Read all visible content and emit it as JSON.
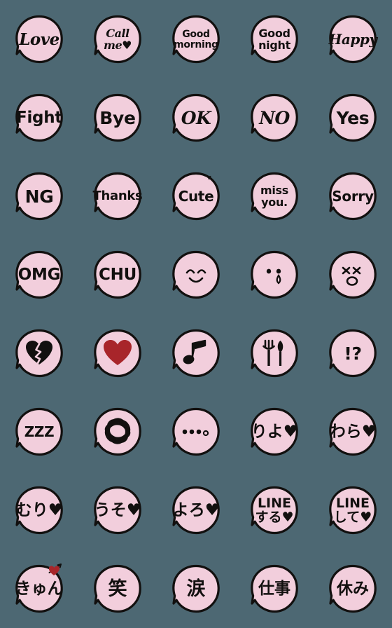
{
  "sheet": {
    "title": "Pink speech bubble emoji set",
    "columns": 5,
    "rows": 8,
    "background_color": "#4d6873",
    "bubble_fill_color": "#f2cedc",
    "bubble_outline_color": "#12100f",
    "ink_color": "#12100f",
    "accent_red": "#a8252a"
  },
  "stickers": [
    {
      "id": "love",
      "kind": "text",
      "style": "script",
      "size": "sz-24",
      "lines": [
        "Love"
      ]
    },
    {
      "id": "call-me",
      "kind": "text",
      "style": "script",
      "size": "sz-17",
      "lines": [
        "Call",
        "me♥"
      ]
    },
    {
      "id": "good-morning",
      "kind": "text",
      "style": "hand",
      "size": "sz-15",
      "lines": [
        "Good",
        "morning"
      ]
    },
    {
      "id": "good-night",
      "kind": "text",
      "style": "hand",
      "size": "sz-17",
      "lines": [
        "Good",
        "night"
      ]
    },
    {
      "id": "happy",
      "kind": "text",
      "style": "script",
      "size": "sz-21",
      "lines": [
        "Happy"
      ]
    },
    {
      "id": "fight",
      "kind": "text",
      "style": "hand",
      "size": "sz-24",
      "lines": [
        "Fight"
      ]
    },
    {
      "id": "bye",
      "kind": "text",
      "style": "hand",
      "size": "sz-28",
      "lines": [
        "Bye"
      ]
    },
    {
      "id": "ok",
      "kind": "text",
      "style": "script",
      "size": "sz-28",
      "lines": [
        "OK"
      ]
    },
    {
      "id": "no",
      "kind": "text",
      "style": "script",
      "size": "sz-28",
      "lines": [
        "NO"
      ]
    },
    {
      "id": "yes",
      "kind": "text",
      "style": "hand",
      "size": "sz-28",
      "lines": [
        "Yes"
      ]
    },
    {
      "id": "ng",
      "kind": "text",
      "style": "hand",
      "size": "sz-28",
      "lines": [
        "NG"
      ]
    },
    {
      "id": "thanks",
      "kind": "text",
      "style": "hand",
      "size": "sz-19",
      "lines": [
        "Thanks"
      ]
    },
    {
      "id": "cute",
      "kind": "text",
      "style": "hand",
      "size": "sz-21",
      "lines": [
        "Cute"
      ],
      "heart_above": true
    },
    {
      "id": "miss-you",
      "kind": "text",
      "style": "hand",
      "size": "sz-17",
      "lines": [
        "miss",
        "you."
      ]
    },
    {
      "id": "sorry",
      "kind": "text",
      "style": "hand",
      "size": "sz-21",
      "lines": [
        "Sorry"
      ]
    },
    {
      "id": "omg",
      "kind": "text",
      "style": "hand",
      "size": "sz-24",
      "lines": [
        "OMG"
      ]
    },
    {
      "id": "chu",
      "kind": "text",
      "style": "hand",
      "size": "sz-24",
      "lines": [
        "CHU"
      ]
    },
    {
      "id": "smiling-face",
      "kind": "icon",
      "icon": "smiling-face-icon",
      "label": "smiling face"
    },
    {
      "id": "crying-face",
      "kind": "icon",
      "icon": "crying-face-icon",
      "label": "crying face with tear"
    },
    {
      "id": "dizzy-face",
      "kind": "icon",
      "icon": "dizzy-face-icon",
      "label": "face with x eyes"
    },
    {
      "id": "broken-heart",
      "kind": "icon",
      "icon": "broken-heart-icon",
      "label": "broken heart"
    },
    {
      "id": "red-heart",
      "kind": "icon",
      "icon": "red-heart-icon",
      "label": "red heart"
    },
    {
      "id": "music-note",
      "kind": "icon",
      "icon": "music-note-icon",
      "label": "eighth note"
    },
    {
      "id": "fork-knife",
      "kind": "icon",
      "icon": "fork-knife-icon",
      "label": "fork and knife"
    },
    {
      "id": "interrobang",
      "kind": "text",
      "style": "hand",
      "size": "sz-28",
      "lines": [
        "!?"
      ]
    },
    {
      "id": "zzz",
      "kind": "text",
      "style": "hand",
      "size": "sz-21",
      "lines": [
        "ZZZ"
      ]
    },
    {
      "id": "scribble",
      "kind": "icon",
      "icon": "scribble-ball-icon",
      "label": "angry scribble"
    },
    {
      "id": "dots",
      "kind": "icon",
      "icon": "ellipsis-dots-icon",
      "label": "four dots"
    },
    {
      "id": "ryo",
      "kind": "text",
      "style": "jp",
      "size": "sz-22jp",
      "lines": [
        "りよ♥"
      ]
    },
    {
      "id": "wara",
      "kind": "text",
      "style": "jp",
      "size": "sz-22jp",
      "lines": [
        "わら♥"
      ]
    },
    {
      "id": "muri",
      "kind": "text",
      "style": "jp",
      "size": "sz-22jp",
      "lines": [
        "むり♥"
      ]
    },
    {
      "id": "uso",
      "kind": "text",
      "style": "jp",
      "size": "sz-22jp",
      "lines": [
        "うそ♥"
      ]
    },
    {
      "id": "yoro",
      "kind": "text",
      "style": "jp",
      "size": "sz-22jp",
      "lines": [
        "よろ♥"
      ]
    },
    {
      "id": "line-suru",
      "kind": "text",
      "style": "jp",
      "size": "sz-18jp",
      "lines": [
        "LINE",
        "する♥"
      ]
    },
    {
      "id": "line-shite",
      "kind": "text",
      "style": "jp",
      "size": "sz-18jp",
      "lines": [
        "LINE",
        "して♥"
      ]
    },
    {
      "id": "kyun",
      "kind": "text",
      "style": "jp",
      "size": "sz-22jp",
      "lines": [
        "きゅん"
      ],
      "arrow_heart": true
    },
    {
      "id": "warai-kanji",
      "kind": "text",
      "style": "jp",
      "size": "sz-26jp",
      "lines": [
        "笑"
      ]
    },
    {
      "id": "namida-kanji",
      "kind": "text",
      "style": "jp",
      "size": "sz-26jp",
      "lines": [
        "涙"
      ]
    },
    {
      "id": "shigoto-kanji",
      "kind": "text",
      "style": "jp",
      "size": "sz-22jp",
      "lines": [
        "仕事"
      ]
    },
    {
      "id": "yasumi-kanji",
      "kind": "text",
      "style": "jp",
      "size": "sz-22jp",
      "lines": [
        "休み"
      ]
    }
  ]
}
